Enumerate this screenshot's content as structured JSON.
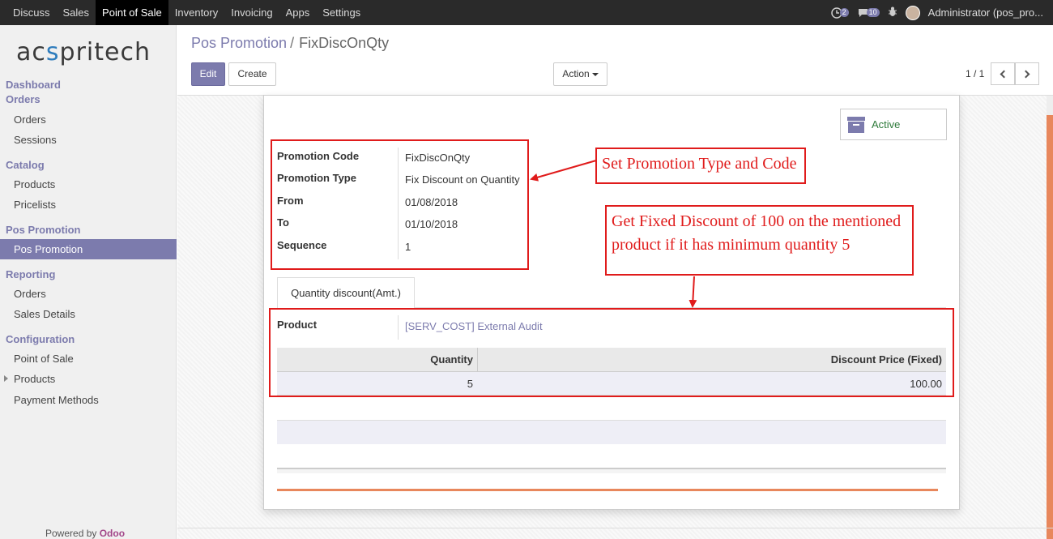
{
  "topbar": {
    "menu": [
      "Discuss",
      "Sales",
      "Point of Sale",
      "Inventory",
      "Invoicing",
      "Apps",
      "Settings"
    ],
    "active_menu": "Point of Sale",
    "activity_count": "2",
    "message_count": "10",
    "user": "Administrator (pos_pro..."
  },
  "sidebar": {
    "logo_left": "ac",
    "logo_mid": "s",
    "logo_right": "pritech",
    "sections": {
      "dashboard": "Dashboard",
      "orders": "Orders",
      "catalog": "Catalog",
      "pos_promotion": "Pos Promotion",
      "reporting": "Reporting",
      "configuration": "Configuration"
    },
    "items": {
      "orders": "Orders",
      "sessions": "Sessions",
      "products": "Products",
      "pricelists": "Pricelists",
      "pos_promotion": "Pos Promotion",
      "rep_orders": "Orders",
      "sales_details": "Sales Details",
      "point_of_sale": "Point of Sale",
      "cfg_products": "Products",
      "payment_methods": "Payment Methods"
    },
    "powered_by": "Powered by",
    "powered_brand": "Odoo"
  },
  "control": {
    "breadcrumb_parent": "Pos Promotion",
    "breadcrumb_sep": "/",
    "breadcrumb_current": "FixDiscOnQty",
    "edit": "Edit",
    "create": "Create",
    "action": "Action",
    "pager": "1 / 1"
  },
  "form": {
    "active_label": "Active",
    "labels": {
      "code": "Promotion Code",
      "type": "Promotion Type",
      "from": "From",
      "to": "To",
      "sequence": "Sequence",
      "product": "Product"
    },
    "values": {
      "code": "FixDiscOnQty",
      "type": "Fix Discount on Quantity",
      "from": "01/08/2018",
      "to": "01/10/2018",
      "sequence": "1",
      "product": "[SERV_COST] External Audit"
    },
    "tab": "Quantity discount(Amt.)",
    "table": {
      "headers": [
        "Quantity",
        "Discount Price (Fixed)"
      ],
      "rows": [
        [
          "5",
          "100.00"
        ]
      ]
    }
  },
  "annotations": {
    "type_code": "Set Promotion Type and Code",
    "fixed_discount": "Get Fixed Discount of 100 on the mentioned product if it has minimum quantity 5"
  },
  "colors": {
    "accent": "#7c7bad",
    "annotation": "#e01b1b",
    "chatter_orange": "#e8875c"
  }
}
